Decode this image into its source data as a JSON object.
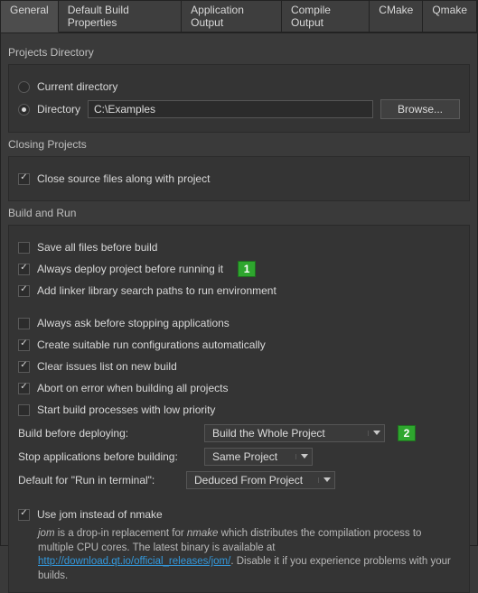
{
  "tabs": {
    "general": "General",
    "default_build_properties": "Default Build Properties",
    "application_output": "Application Output",
    "compile_output": "Compile Output",
    "cmake": "CMake",
    "qmake": "Qmake"
  },
  "sections": {
    "projects_directory": "Projects Directory",
    "closing_projects": "Closing Projects",
    "build_and_run": "Build and Run"
  },
  "projects_dir": {
    "current_directory": "Current directory",
    "directory": "Directory",
    "path": "C:\\Examples",
    "browse": "Browse..."
  },
  "closing": {
    "close_source_files": "Close source files along with project"
  },
  "build_run": {
    "save_all": "Save all files before build",
    "always_deploy": "Always deploy project before running it",
    "add_linker": "Add linker library search paths to run environment",
    "always_ask_stop": "Always ask before stopping applications",
    "create_run_configs": "Create suitable run configurations automatically",
    "clear_issues": "Clear issues list on new build",
    "abort_on_error": "Abort on error when building all projects",
    "low_priority": "Start build processes with low priority",
    "build_before_deploying_label": "Build before deploying:",
    "build_before_deploying_value": "Build the Whole Project",
    "stop_before_building_label": "Stop applications before building:",
    "stop_before_building_value": "Same Project",
    "run_in_terminal_label": "Default for \"Run in terminal\":",
    "run_in_terminal_value": "Deduced From Project",
    "use_jom": "Use jom instead of nmake",
    "jom_help_pre": "jom",
    "jom_help_1": " is a drop-in replacement for ",
    "jom_help_nmake": "nmake",
    "jom_help_2": " which distributes the compilation process to multiple CPU cores. The latest binary is available at ",
    "jom_help_url": "http://download.qt.io/official_releases/jom/",
    "jom_help_3": ". Disable it if you experience problems with your builds."
  },
  "callouts": {
    "c1": "1",
    "c2": "2"
  }
}
